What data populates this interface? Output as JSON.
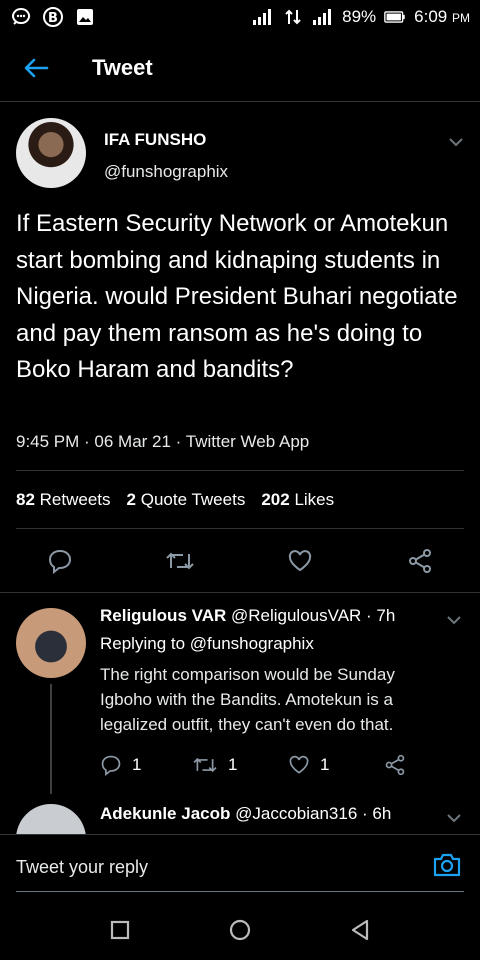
{
  "status_bar": {
    "battery": "89%",
    "time": "6:09",
    "time_suffix": "PM",
    "icons": [
      "chat-bubble-icon",
      "b-badge-icon",
      "image-icon",
      "signal-icon",
      "data-arrows-icon",
      "signal-icon",
      "battery-icon"
    ]
  },
  "header": {
    "title": "Tweet",
    "back_icon": "back-arrow-icon"
  },
  "tweet": {
    "author_name": "IFA FUNSHO",
    "handle": "@funshographix",
    "text": "If Eastern Security Network or Amotekun start bombing and kidnaping students in Nigeria. would President Buhari negotiate and pay them ransom as he's doing to Boko Haram and bandits?",
    "meta": "9:45 PM · 06 Mar 21 · Twitter Web App",
    "retweets_count": "82",
    "retweets_label": "Retweets",
    "quotes_count": "2",
    "quotes_label": "Quote Tweets",
    "likes_count": "202",
    "likes_label": "Likes",
    "actions": [
      "reply-icon",
      "retweet-icon",
      "like-icon",
      "share-icon"
    ]
  },
  "replies": [
    {
      "name": "Religulous VAR",
      "handle_time": "@ReligulousVAR · 7h",
      "replying_to": "Replying to @funshographix",
      "text": "The right comparison would be Sunday Igboho with the Bandits. Amotekun is a legalized outfit, they can't even do that.",
      "reply_count": "1",
      "retweet_count": "1",
      "like_count": "1"
    },
    {
      "name": "Adekunle Jacob",
      "handle_time": "@Jaccobian316 · 6h"
    }
  ],
  "composer": {
    "placeholder": "Tweet your reply",
    "camera_icon": "camera-icon"
  },
  "nav": [
    "recents-square-icon",
    "home-circle-icon",
    "back-triangle-icon"
  ],
  "colors": {
    "accent": "#1da1f2",
    "background": "#000000",
    "divider": "#2f3336",
    "icon_gray": "#8b98a5"
  }
}
